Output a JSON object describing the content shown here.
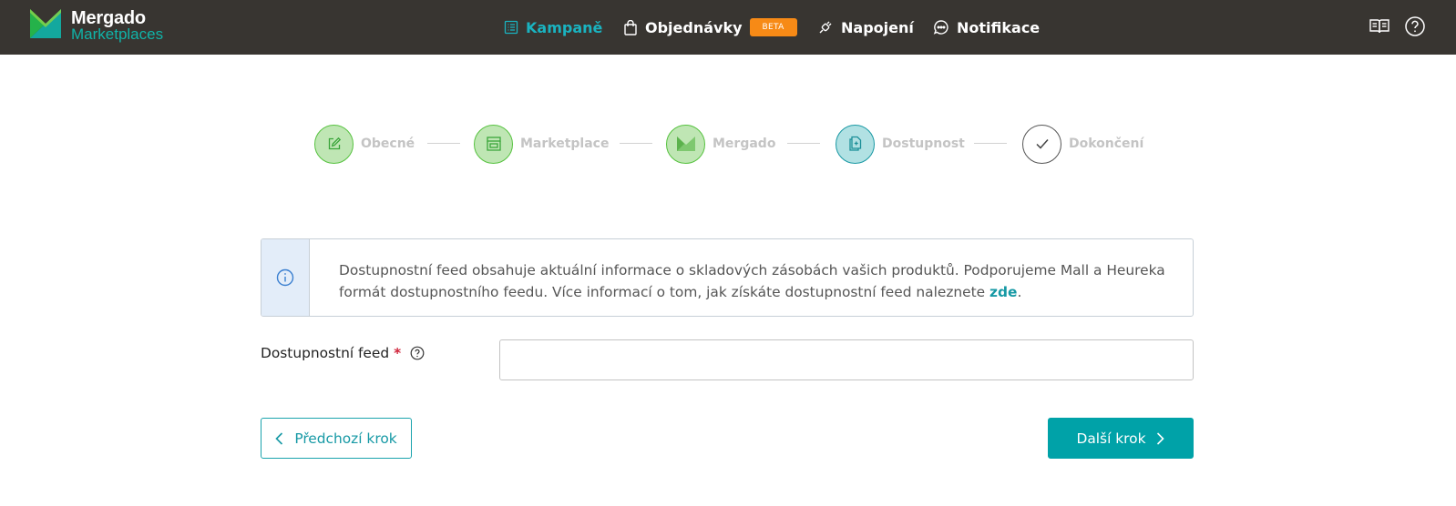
{
  "app": {
    "logo_line1": "Mergado",
    "logo_line2": "Marketplaces"
  },
  "nav": {
    "items": [
      {
        "label": "Kampaně",
        "icon": "list-icon",
        "active": true
      },
      {
        "label": "Objednávky",
        "icon": "shopping-bag-icon",
        "badge": "BETA"
      },
      {
        "label": "Napojení",
        "icon": "plug-icon"
      },
      {
        "label": "Notifikace",
        "icon": "chat-bubble-icon"
      }
    ],
    "right_icons": [
      "book-icon",
      "help-icon"
    ]
  },
  "stepper": {
    "steps": [
      {
        "label": "Obecné",
        "state": "done",
        "icon": "edit-icon"
      },
      {
        "label": "Marketplace",
        "state": "done",
        "icon": "store-icon"
      },
      {
        "label": "Mergado",
        "state": "done",
        "icon": "mergado-logo-icon"
      },
      {
        "label": "Dostupnost",
        "state": "current",
        "icon": "document-icon"
      },
      {
        "label": "Dokončení",
        "state": "todo",
        "icon": "check-icon"
      }
    ]
  },
  "info": {
    "text": "Dostupnostní feed obsahuje aktuální informace o skladových zásobách vašich produktů. Podporujeme Mall a Heureka formát dostupnostního feedu. Více informací o tom, jak získáte dostupnostní feed naleznete ",
    "link": "zde",
    "suffix": "."
  },
  "form": {
    "feed_label": "Dostupnostní feed",
    "required_mark": "*",
    "feed_value": ""
  },
  "buttons": {
    "prev": "Předchozí krok",
    "next": "Další krok"
  },
  "colors": {
    "topbar": "#383531",
    "accent": "#00a2a8",
    "active_nav": "#1ab3c0",
    "badge": "#f78a16",
    "step_done": "#bfe6b4",
    "step_current": "#b1e1e3"
  }
}
